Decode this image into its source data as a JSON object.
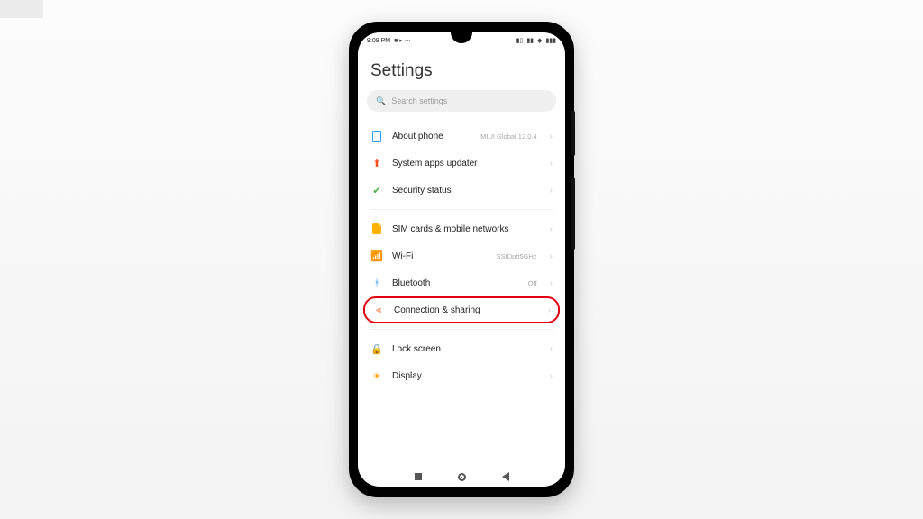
{
  "status": {
    "time": "9:09 PM",
    "icons_left": "📷 ▶ ⋯",
    "icons_right": "📶 📶 📡 🔋"
  },
  "page_title": "Settings",
  "search_placeholder": "Search settings",
  "groups": [
    {
      "items": [
        {
          "id": "about",
          "label": "About phone",
          "value": "MIUI Global 12.0.4"
        },
        {
          "id": "update",
          "label": "System apps updater",
          "value": ""
        },
        {
          "id": "secure",
          "label": "Security status",
          "value": ""
        }
      ]
    },
    {
      "items": [
        {
          "id": "sim",
          "label": "SIM cards & mobile networks",
          "value": ""
        },
        {
          "id": "wifi",
          "label": "Wi-Fi",
          "value": "SSIDptt5GHz"
        },
        {
          "id": "bt",
          "label": "Bluetooth",
          "value": "Off"
        },
        {
          "id": "conn",
          "label": "Connection & sharing",
          "value": "",
          "highlighted": true
        }
      ]
    },
    {
      "items": [
        {
          "id": "lock",
          "label": "Lock screen",
          "value": ""
        },
        {
          "id": "display",
          "label": "Display",
          "value": ""
        }
      ]
    }
  ]
}
